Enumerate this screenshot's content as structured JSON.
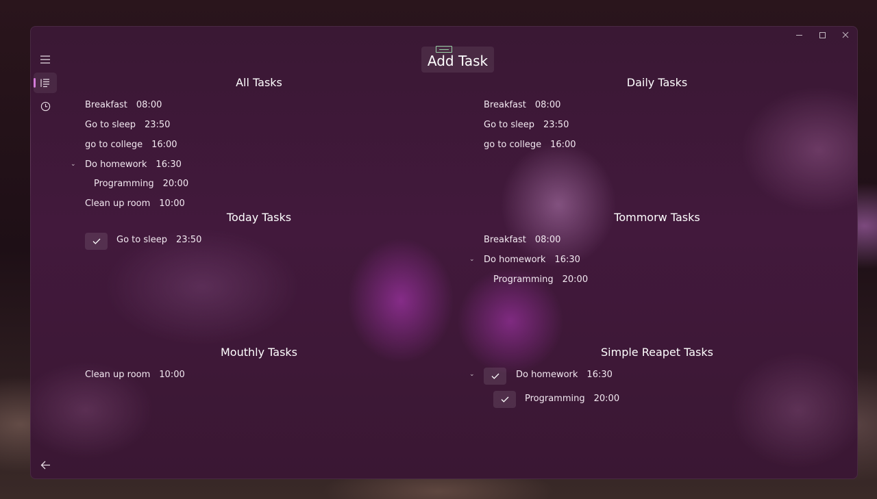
{
  "add_task": {
    "label": "Add Task"
  },
  "sections": {
    "all": {
      "title": "All Tasks",
      "items": [
        {
          "name": "Breakfast",
          "time": "08:00"
        },
        {
          "name": "Go to sleep",
          "time": "23:50"
        },
        {
          "name": "go to college",
          "time": "16:00"
        },
        {
          "name": "Do homework",
          "time": "16:30",
          "expanded": true
        },
        {
          "name": "Programming",
          "time": "20:00",
          "child": true
        },
        {
          "name": "Clean up room",
          "time": "10:00"
        }
      ]
    },
    "daily": {
      "title": "Daily Tasks",
      "items": [
        {
          "name": "Breakfast",
          "time": "08:00"
        },
        {
          "name": "Go to sleep",
          "time": "23:50"
        },
        {
          "name": "go to college",
          "time": "16:00"
        }
      ]
    },
    "today": {
      "title": "Today Tasks",
      "items": [
        {
          "name": "Go to sleep",
          "time": "23:50",
          "checked": true
        }
      ]
    },
    "tomorrow": {
      "title": "Tommorw Tasks",
      "items": [
        {
          "name": "Breakfast",
          "time": "08:00"
        },
        {
          "name": "Do homework",
          "time": "16:30",
          "expanded": true
        },
        {
          "name": "Programming",
          "time": "20:00",
          "child": true
        }
      ]
    },
    "monthly": {
      "title": "Mouthly Tasks",
      "items": [
        {
          "name": "Clean up room",
          "time": "10:00"
        }
      ]
    },
    "simple_repeat": {
      "title": "Simple Reapet Tasks",
      "items": [
        {
          "name": "Do homework",
          "time": "16:30",
          "expanded": true,
          "checked": true
        },
        {
          "name": "Programming",
          "time": "20:00",
          "child": true,
          "checked": true
        }
      ]
    }
  },
  "icons": {
    "menu": "hamburger-menu-icon",
    "list": "bulleted-list-icon",
    "history": "clock-icon",
    "back": "back-arrow-icon",
    "expand": "chevron-down-icon",
    "check": "checkmark-icon"
  },
  "colors": {
    "accent": "#d37ad8",
    "window_bg": "#3f1839"
  }
}
